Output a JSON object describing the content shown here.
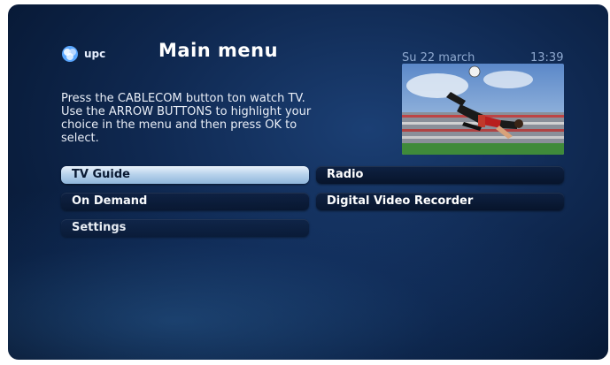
{
  "header": {
    "logo_text": "upc",
    "title": "Main menu",
    "date": "Su 22 march",
    "time": "13:39"
  },
  "instructions": "Press the CABLECOM button ton watch TV.\nUse the ARROW BUTTONS to highlight your\nchoice in the menu and then press OK to\nselect.",
  "menu": {
    "tv_guide": "TV Guide",
    "on_demand": "On Demand",
    "settings": "Settings",
    "radio": "Radio",
    "dvr": "Digital Video Recorder",
    "selected": "tv_guide"
  },
  "colors": {
    "background": "#0f2850",
    "highlight": "#b9d3ec",
    "text": "#ffffff",
    "datetime": "#8fa9cf"
  }
}
